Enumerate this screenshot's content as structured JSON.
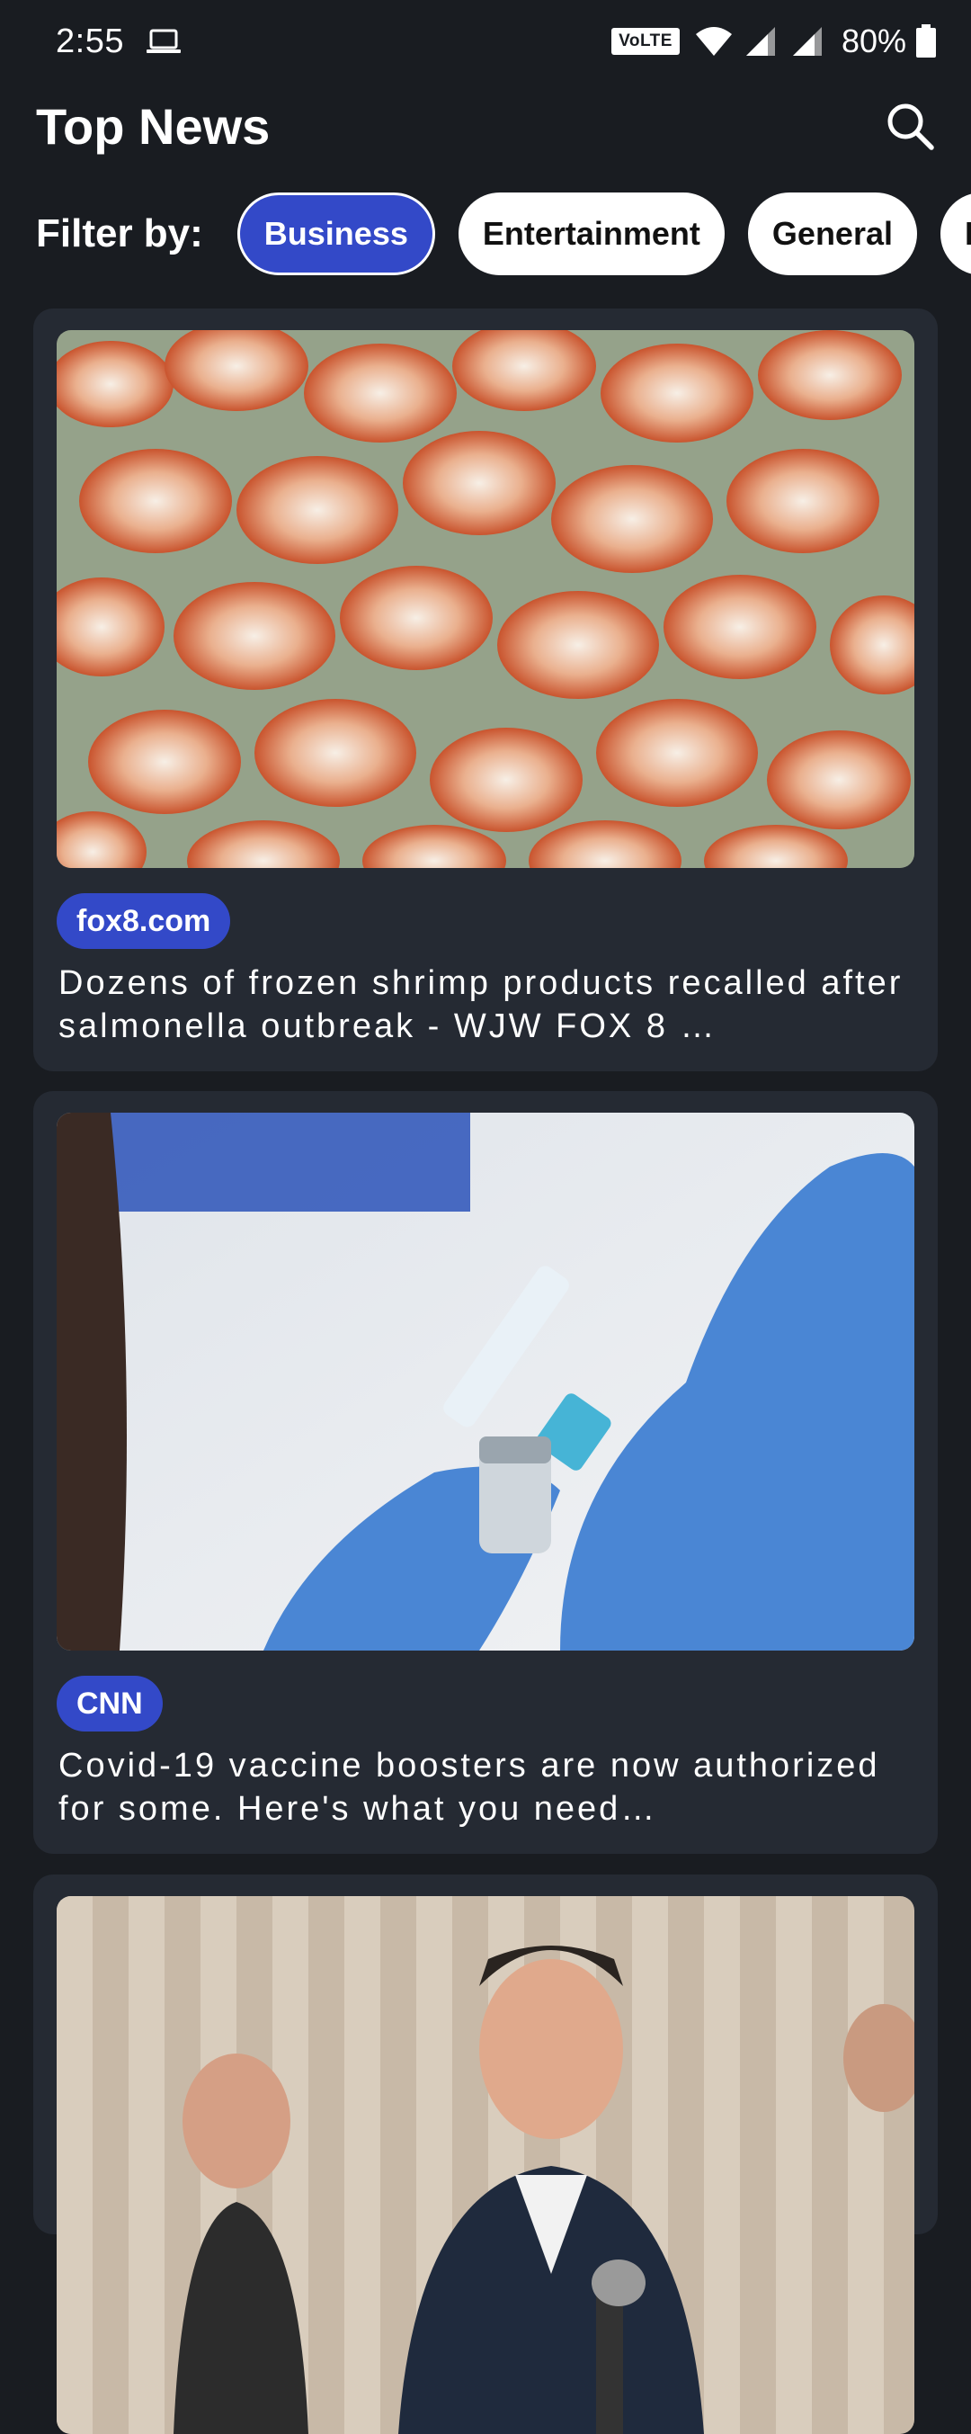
{
  "status_bar": {
    "time": "2:55",
    "volte": "VoLTE",
    "battery": "80%"
  },
  "app_bar": {
    "title": "Top News"
  },
  "filter": {
    "label": "Filter by:",
    "chips": [
      "Business",
      "Entertainment",
      "General",
      "Health"
    ],
    "selected": "Business"
  },
  "articles": [
    {
      "source": "fox8.com",
      "title": "Dozens of frozen shrimp products recalled after salmonella outbreak - WJW FOX 8 …",
      "image_desc": "Pile of cooked shrimp on ice"
    },
    {
      "source": "CNN",
      "title": "Covid-19 vaccine boosters are now authorized for some. Here's what you need…",
      "image_desc": "Gloved hands drawing vaccine from vial with syringe"
    },
    {
      "source": "",
      "title": "",
      "image_desc": "Man speaking at a press conference podium"
    }
  ],
  "colors": {
    "background": "#191c21",
    "card": "#252a33",
    "accent": "#3349c8"
  }
}
